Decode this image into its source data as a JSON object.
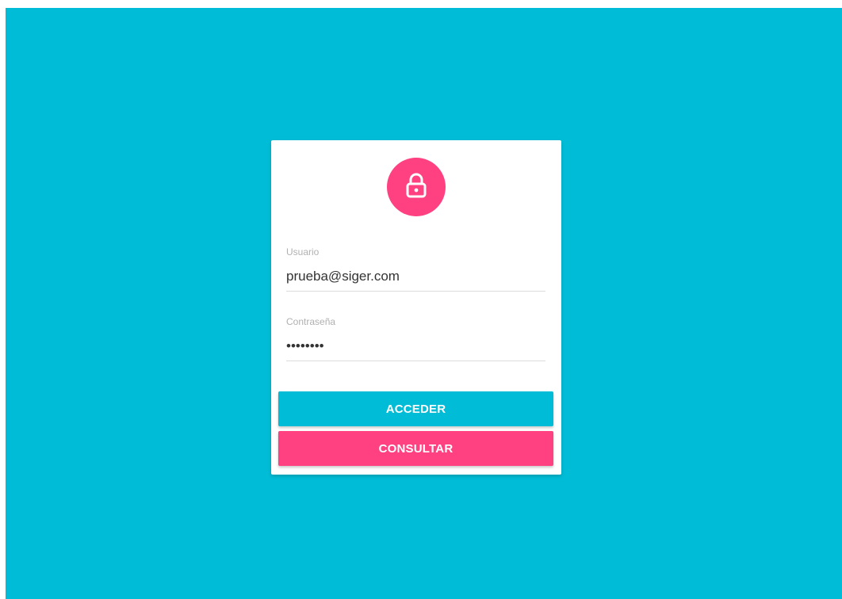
{
  "theme": {
    "background": "#00bcd6",
    "accent": "#ff4081",
    "card": "#ffffff"
  },
  "login": {
    "icon": "lock-icon",
    "username": {
      "label": "Usuario",
      "value": "prueba@siger.com"
    },
    "password": {
      "label": "Contraseña",
      "value": "********"
    },
    "buttons": {
      "login_label": "ACCEDER",
      "consult_label": "CONSULTAR"
    }
  }
}
